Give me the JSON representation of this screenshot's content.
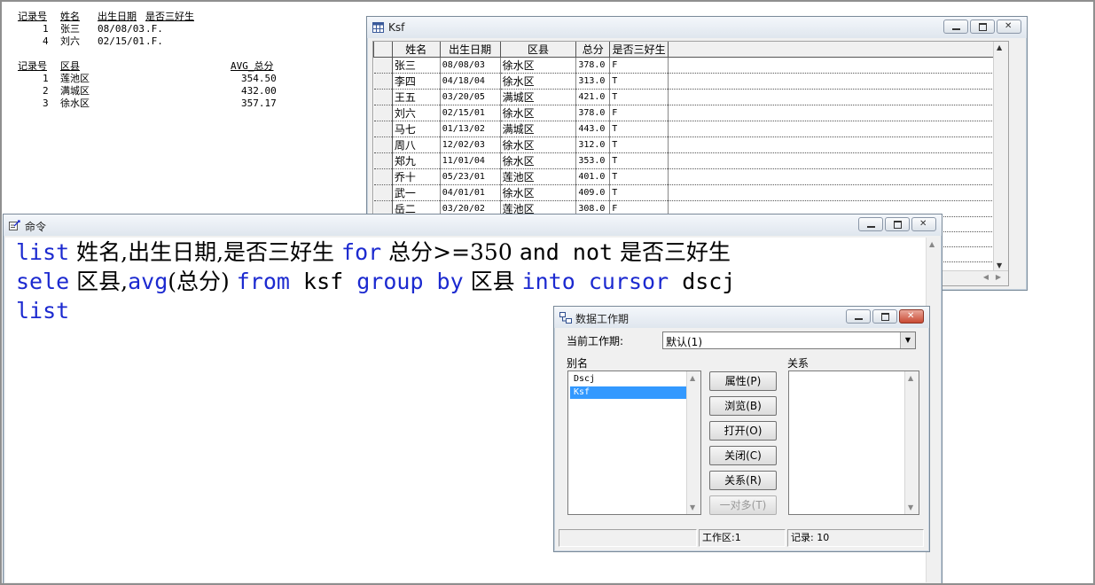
{
  "output": {
    "table1": {
      "headers": [
        "记录号",
        "姓名",
        "出生日期",
        "是否三好生"
      ],
      "rows": [
        [
          "1",
          "张三",
          "08/08/03",
          ".F."
        ],
        [
          "4",
          "刘六",
          "02/15/01",
          ".F."
        ]
      ]
    },
    "table2": {
      "headers": [
        "记录号",
        "区县",
        "AVG_总分"
      ],
      "rows": [
        [
          "1",
          "莲池区",
          "354.50"
        ],
        [
          "2",
          "满城区",
          "432.00"
        ],
        [
          "3",
          "徐水区",
          "357.17"
        ]
      ]
    }
  },
  "ksf": {
    "title": "Ksf",
    "columns": [
      "姓名",
      "出生日期",
      "区县",
      "总分",
      "是否三好生"
    ],
    "rows": [
      [
        "张三",
        "08/08/03",
        "徐水区",
        "378.0",
        "F"
      ],
      [
        "李四",
        "04/18/04",
        "徐水区",
        "313.0",
        "T"
      ],
      [
        "王五",
        "03/20/05",
        "满城区",
        "421.0",
        "T"
      ],
      [
        "刘六",
        "02/15/01",
        "徐水区",
        "378.0",
        "F"
      ],
      [
        "马七",
        "01/13/02",
        "满城区",
        "443.0",
        "T"
      ],
      [
        "周八",
        "12/02/03",
        "徐水区",
        "312.0",
        "T"
      ],
      [
        "郑九",
        "11/01/04",
        "徐水区",
        "353.0",
        "T"
      ],
      [
        "乔十",
        "05/23/01",
        "莲池区",
        "401.0",
        "T"
      ],
      [
        "武一",
        "04/01/01",
        "徐水区",
        "409.0",
        "T"
      ],
      [
        "岳二",
        "03/20/02",
        "莲池区",
        "308.0",
        "F"
      ]
    ]
  },
  "command": {
    "title": "命令",
    "line1": [
      {
        "t": "list",
        "k": true
      },
      {
        "t": " 姓名,出生日期,是否三好生 ",
        "k": false
      },
      {
        "t": "for",
        "k": true
      },
      {
        "t": " 总分>=350 ",
        "k": false
      },
      {
        "t": "and not",
        "k": false,
        "m": true
      },
      {
        "t": " 是否三好生",
        "k": false
      }
    ],
    "line2": [
      {
        "t": "sele",
        "k": true
      },
      {
        "t": " 区县,",
        "k": false
      },
      {
        "t": "avg",
        "k": true
      },
      {
        "t": "(总分) ",
        "k": false
      },
      {
        "t": "from",
        "k": true
      },
      {
        "t": " ksf ",
        "k": false,
        "m": true
      },
      {
        "t": "group by",
        "k": true
      },
      {
        "t": " 区县 ",
        "k": false
      },
      {
        "t": "into cursor",
        "k": true
      },
      {
        "t": " dscj",
        "k": false,
        "m": true
      }
    ],
    "line3": [
      {
        "t": "list",
        "k": true
      }
    ]
  },
  "session": {
    "title": "数据工作期",
    "current_label": "当前工作期:",
    "current_value": "默认(1)",
    "alias_label": "别名",
    "relation_label": "关系",
    "aliases": [
      "Dscj",
      "Ksf"
    ],
    "selected_alias": "Ksf",
    "buttons": {
      "properties": "属性(P)",
      "browse": "浏览(B)",
      "open": "打开(O)",
      "close": "关闭(C)",
      "relations": "关系(R)",
      "one_to_many": "一对多(T)"
    },
    "status": {
      "work_area": "工作区:1",
      "records": "记录: 10"
    }
  }
}
